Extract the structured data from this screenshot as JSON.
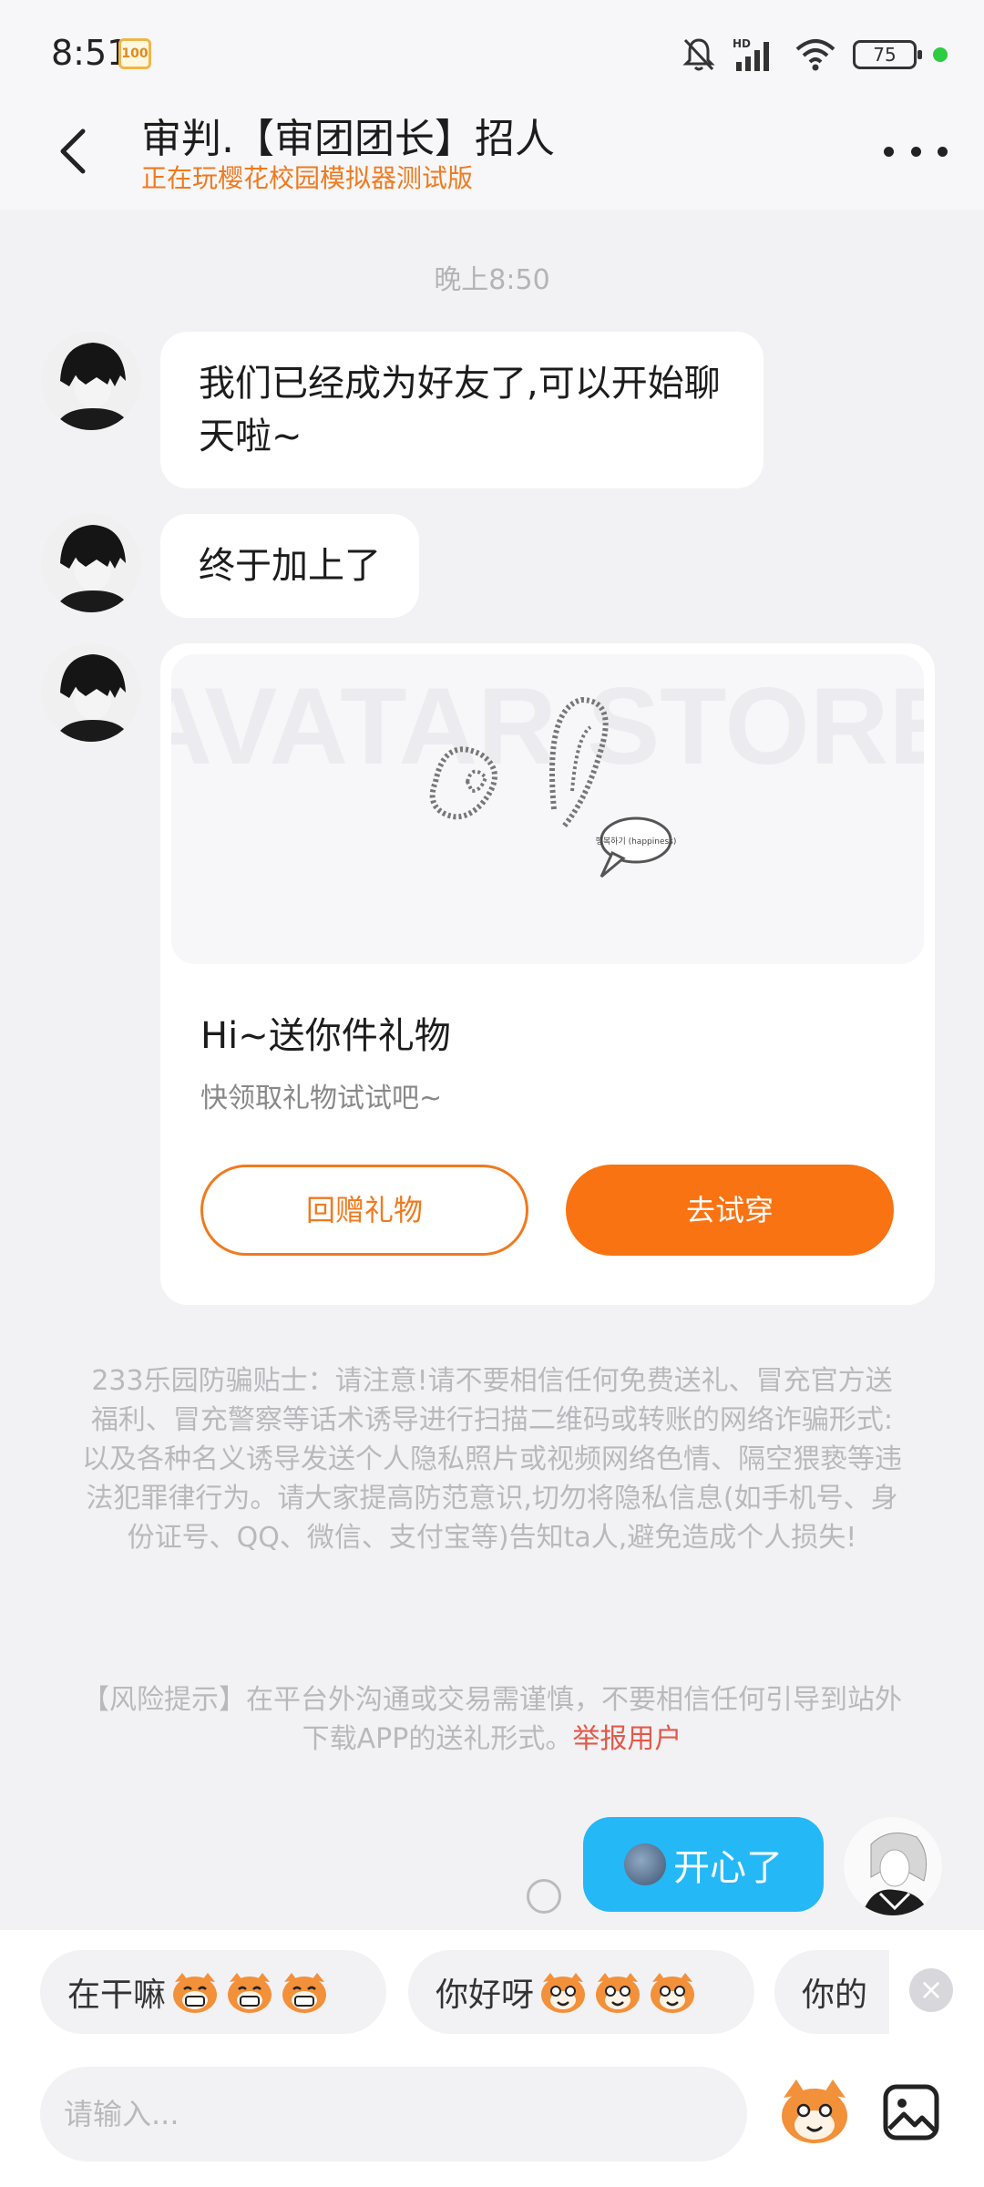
{
  "status_bar": {
    "time": "8:51",
    "badge": "100",
    "battery": "75"
  },
  "header": {
    "title": "审判.【审团团长】招人",
    "subtitle": "正在玩樱花校园模拟器测试版"
  },
  "messages": {
    "timestamp": "晚上8:50",
    "msg1": "我们已经成为好友了,可以开始聊天啦~",
    "msg2": "终于加上了",
    "gift": {
      "title": "Hi~送你件礼物",
      "desc": "快领取礼物试试吧~",
      "return_label": "回赠礼物",
      "try_label": "去试穿",
      "image_text": "AVATAR STORE",
      "speech_text": "행복하기 (happiness)"
    },
    "my_msg": "开心了"
  },
  "notices": {
    "safety": "233乐园防骗贴士：请注意!请不要相信任何免费送礼、冒充官方送福利、冒充警察等话术诱导进行扫描二维码或转账的网络诈骗形式:以及各种名义诱导发送个人隐私照片或视频网络色情、隔空猥亵等违法犯罪律行为。请大家提高防范意识,切勿将隐私信息(如手机号、身份证号、QQ、微信、支付宝等)告知ta人,避免造成个人损失!",
    "risk": "【风险提示】在平台外沟通或交易需谨慎，不要相信任何引导到站外下载APP的送礼形式。",
    "report": "举报用户"
  },
  "quick_replies": [
    "在干嘛",
    "你好呀",
    "你的"
  ],
  "input": {
    "placeholder": "请输入..."
  },
  "colors": {
    "accent": "#fa7312",
    "subtitle": "#f07a1e",
    "my_bubble": "#24b8f7",
    "link": "#e25a4a"
  }
}
